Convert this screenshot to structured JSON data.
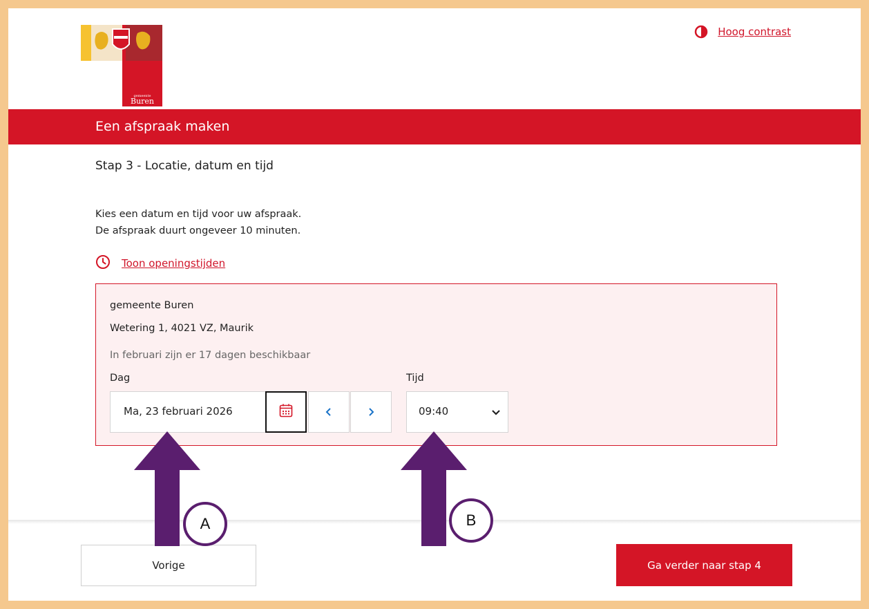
{
  "header": {
    "logo_text_small": "gemeente",
    "logo_text": "Buren",
    "contrast_label": "Hoog contrast"
  },
  "banner": {
    "title": "Een afspraak maken"
  },
  "step": {
    "title": "Stap 3 - Locatie, datum en tijd",
    "intro_line1": "Kies een datum en tijd voor uw afspraak.",
    "intro_line2": "De afspraak duurt ongeveer 10 minuten.",
    "hours_link": "Toon openingstijden"
  },
  "location": {
    "name": "gemeente Buren",
    "address": "Wetering 1, 4021 VZ, Maurik",
    "availability": "In februari zijn er 17 dagen beschikbaar"
  },
  "form": {
    "day_label": "Dag",
    "day_value": "Ma, 23 februari 2026",
    "time_label": "Tijd",
    "time_value": "09:40"
  },
  "footer": {
    "prev_label": "Vorige",
    "next_label": "Ga verder naar stap 4"
  },
  "annotations": {
    "marker_a": "A",
    "marker_b": "B"
  },
  "colors": {
    "brand_red": "#d41526",
    "annotation_purple": "#5a1e6e",
    "frame": "#f5c88e",
    "link_blue": "#1a73c8"
  }
}
